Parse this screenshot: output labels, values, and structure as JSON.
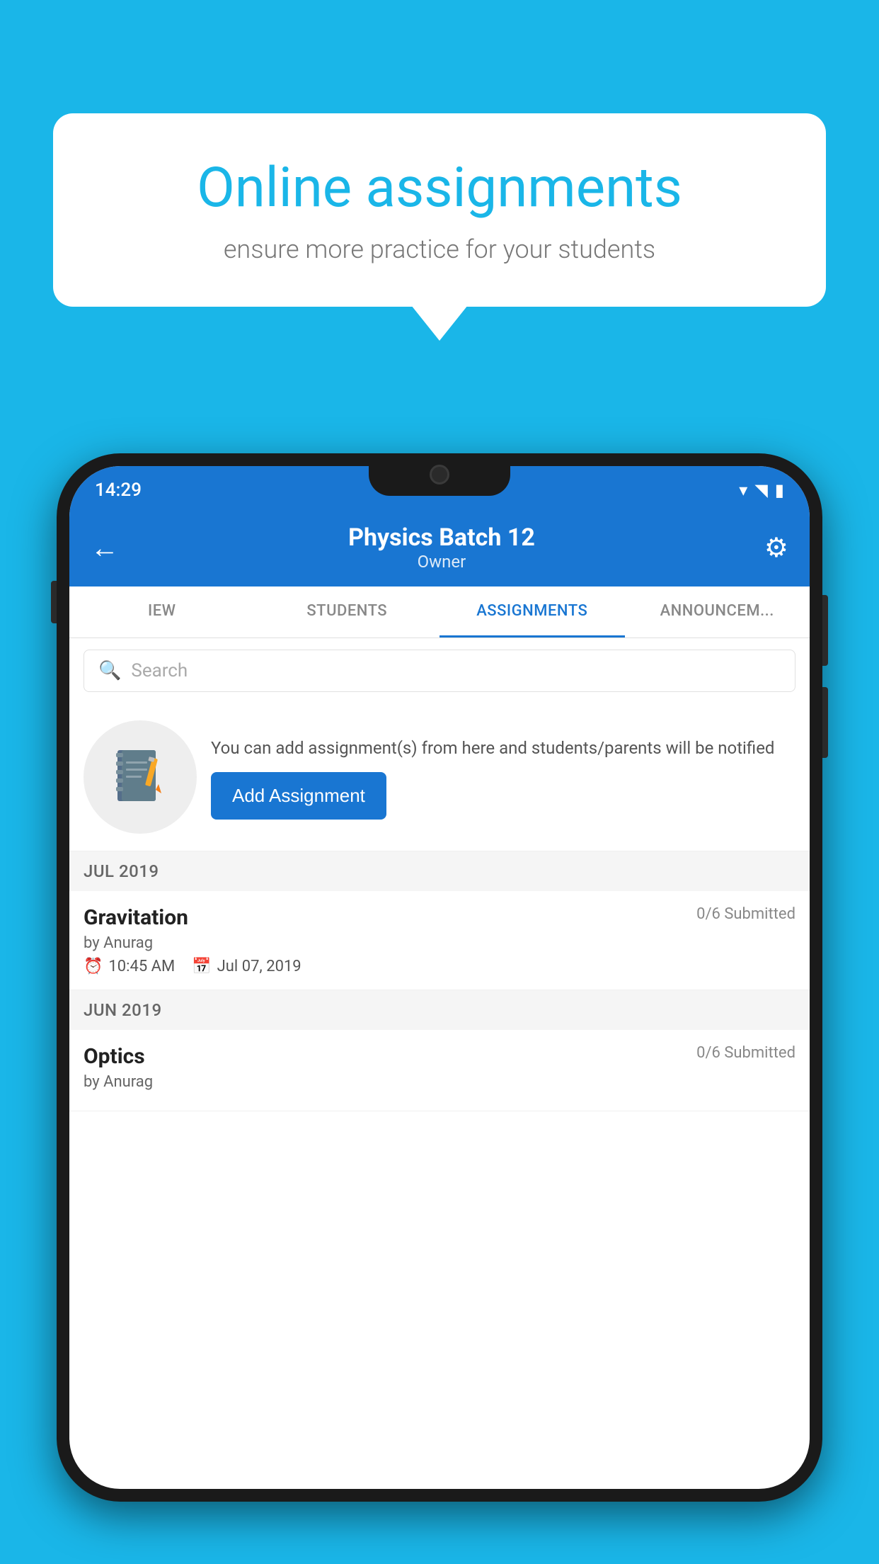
{
  "background": {
    "color": "#1ab6e8"
  },
  "speech_bubble": {
    "title": "Online assignments",
    "subtitle": "ensure more practice for your students"
  },
  "phone": {
    "status_bar": {
      "time": "14:29",
      "icons": [
        "wifi",
        "signal",
        "battery"
      ]
    },
    "header": {
      "title": "Physics Batch 12",
      "subtitle": "Owner",
      "back_label": "←",
      "settings_label": "⚙"
    },
    "tabs": [
      {
        "label": "IEW",
        "active": false
      },
      {
        "label": "STUDENTS",
        "active": false
      },
      {
        "label": "ASSIGNMENTS",
        "active": true
      },
      {
        "label": "ANNOUNCEM...",
        "active": false
      }
    ],
    "search": {
      "placeholder": "Search"
    },
    "promo": {
      "text": "You can add assignment(s) from here and students/parents will be notified",
      "button_label": "Add Assignment"
    },
    "sections": [
      {
        "month_label": "JUL 2019",
        "assignments": [
          {
            "name": "Gravitation",
            "submitted": "0/6 Submitted",
            "author": "by Anurag",
            "time": "10:45 AM",
            "date": "Jul 07, 2019"
          }
        ]
      },
      {
        "month_label": "JUN 2019",
        "assignments": [
          {
            "name": "Optics",
            "submitted": "0/6 Submitted",
            "author": "by Anurag",
            "time": "",
            "date": ""
          }
        ]
      }
    ]
  }
}
